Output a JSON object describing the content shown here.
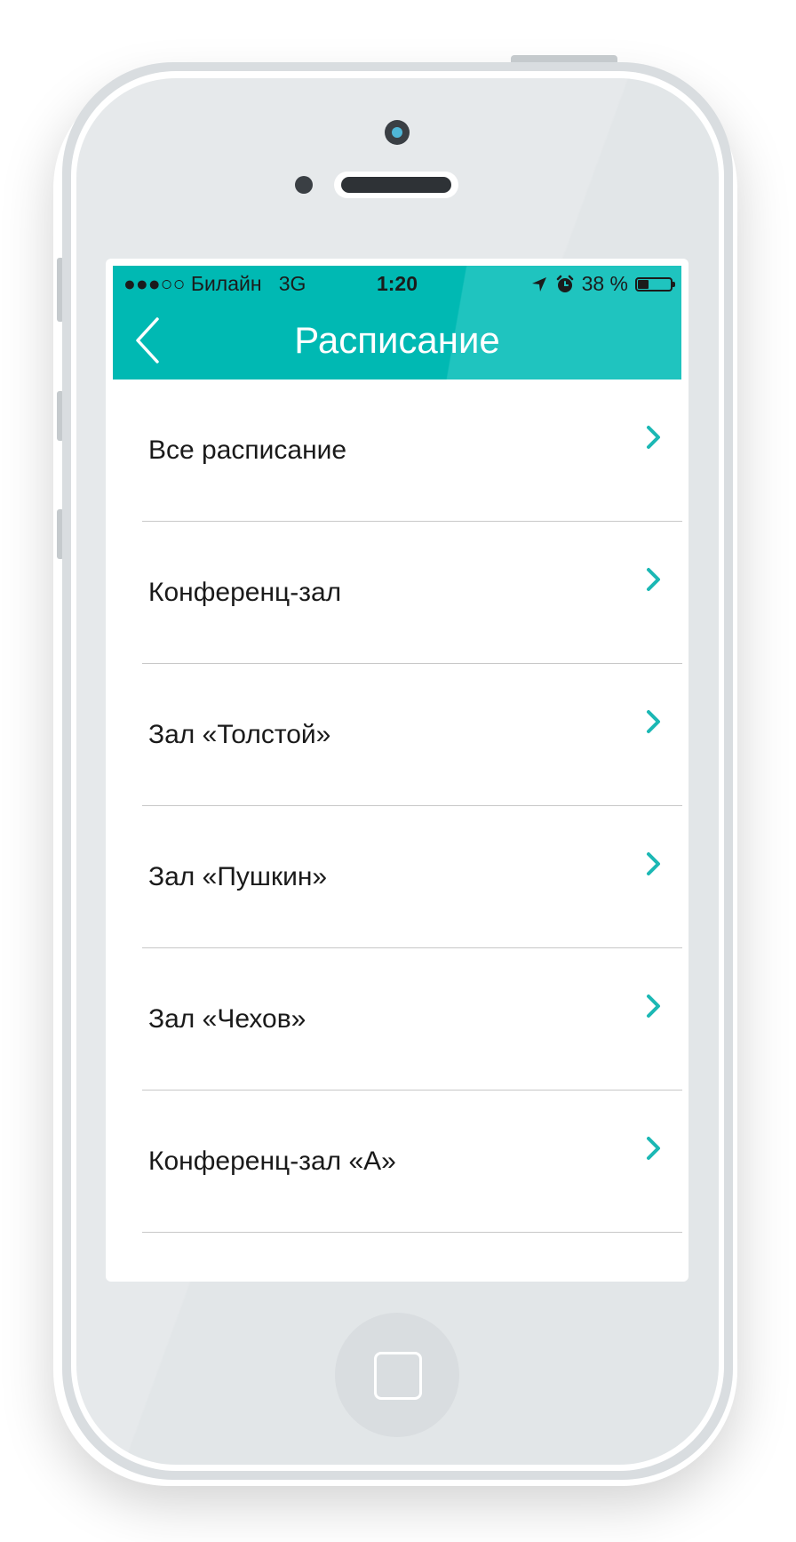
{
  "status_bar": {
    "signal": "●●●○○",
    "carrier": "Билайн",
    "network": "3G",
    "time": "1:20",
    "location_icon": "location-arrow-icon",
    "alarm_icon": "alarm-clock-icon",
    "battery_text": "38 %",
    "battery_level": 0.38
  },
  "nav": {
    "back_icon": "chevron-left-icon",
    "title": "Расписание"
  },
  "colors": {
    "accent": "#00b9b3",
    "chevron": "#1bb8b4"
  },
  "list": {
    "items": [
      {
        "label": "Все расписание"
      },
      {
        "label": "Конференц-зал"
      },
      {
        "label": "Зал «Толстой»"
      },
      {
        "label": "Зал «Пушкин»"
      },
      {
        "label": "Зал «Чехов»"
      },
      {
        "label": "Конференц-зал «А»"
      }
    ],
    "chevron_icon": "chevron-right-icon"
  }
}
